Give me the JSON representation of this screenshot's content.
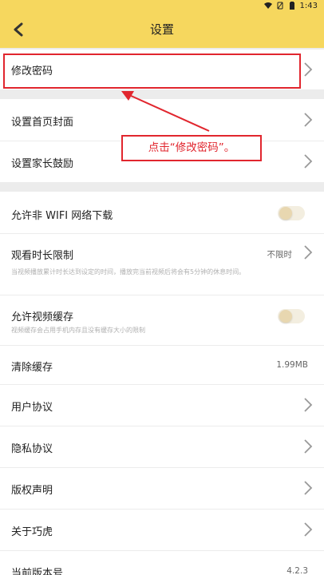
{
  "status_bar": {
    "time": "1:43"
  },
  "header": {
    "title": "设置",
    "back_icon": "back-arrow-icon"
  },
  "rows": {
    "change_password": "修改密码",
    "set_cover": "设置首页封面",
    "parent_encourage": "设置家长鼓励",
    "allow_non_wifi": "允许非 WIFI 网络下载",
    "watch_limit": {
      "label": "观看时长限制",
      "value": "不限时",
      "sub": "当视频播放累计时长达到设定的时间，播放完当前视频后将会有5分钟的休息时间。"
    },
    "video_cache": {
      "label": "允许视频缓存",
      "sub": "视频缓存会占用手机内存且没有缓存大小的限制"
    },
    "clear_cache": {
      "label": "清除缓存",
      "value": "1.99MB"
    },
    "user_agreement": "用户协议",
    "privacy_agreement": "隐私协议",
    "copyright": "版权声明",
    "about": "关于巧虎",
    "version": {
      "label": "当前版本号",
      "value": "4.2.3"
    }
  },
  "annotation": {
    "callout_text": "点击“修改密码”。"
  },
  "colors": {
    "header_bg": "#f6d75e",
    "annotation_red": "#e1262e",
    "toggle_off": "#f3eee0"
  }
}
